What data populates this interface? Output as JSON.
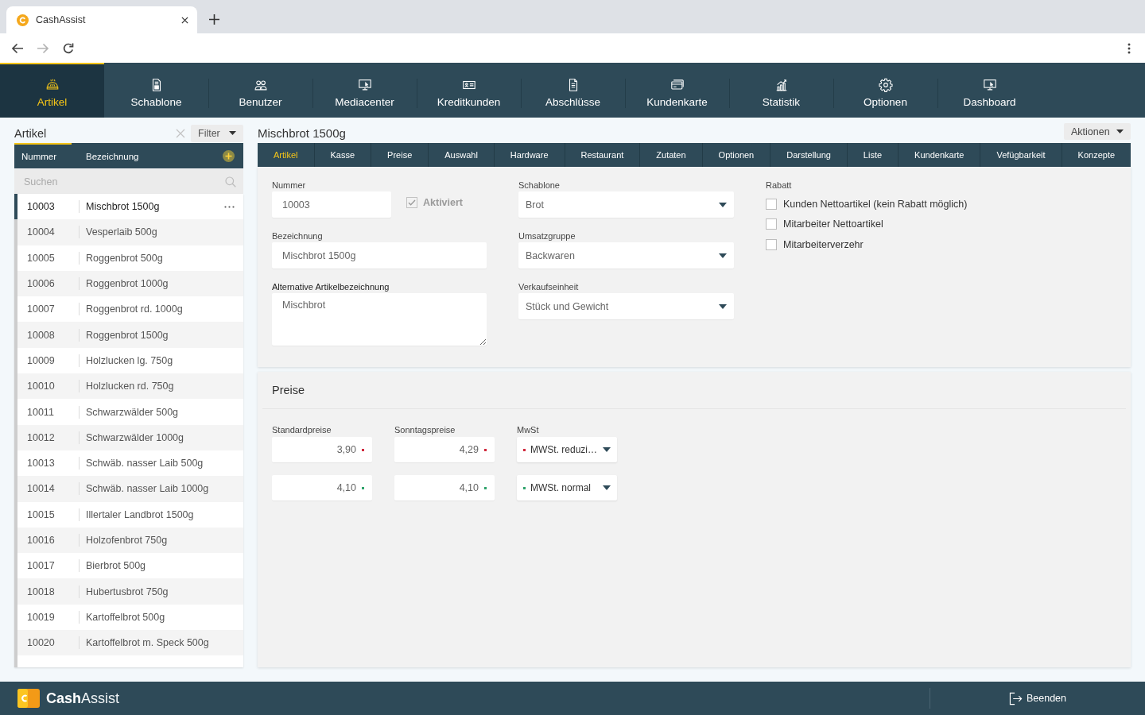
{
  "browser": {
    "tab": {
      "title": "CashAssist"
    },
    "nav_buttons": [
      {
        "kind": "back",
        "disabled": false
      },
      {
        "kind": "forward",
        "disabled": true
      },
      {
        "kind": "reload",
        "disabled": false
      }
    ]
  },
  "main_nav": [
    {
      "label": "Artikel",
      "selected": true
    },
    {
      "label": "Schablone",
      "selected": false
    },
    {
      "label": "Benutzer",
      "selected": false
    },
    {
      "label": "Mediacenter",
      "selected": false
    },
    {
      "label": "Kreditkunden",
      "selected": false
    },
    {
      "label": "Abschlüsse",
      "selected": false
    },
    {
      "label": "Kundenkarte",
      "selected": false
    },
    {
      "label": "Statistik",
      "selected": false
    },
    {
      "label": "Optionen",
      "selected": false
    },
    {
      "label": "Dashboard",
      "selected": false
    }
  ],
  "article_list": {
    "title": "Artikel",
    "filter": "Filter",
    "columns": [
      {
        "label": "Nummer",
        "selected": true
      },
      {
        "label": "Bezeichnung",
        "selected": false
      }
    ],
    "search": {
      "placeholder": "Suchen"
    },
    "rows": [
      {
        "number": "10003",
        "name": "Mischbrot 1500g",
        "selected": true
      },
      {
        "number": "10004",
        "name": "Vesperlaib 500g",
        "selected": false
      },
      {
        "number": "10005",
        "name": "Roggenbrot 500g",
        "selected": false
      },
      {
        "number": "10006",
        "name": "Roggenbrot 1000g",
        "selected": false
      },
      {
        "number": "10007",
        "name": "Roggenbrot rd. 1000g",
        "selected": false
      },
      {
        "number": "10008",
        "name": "Roggenbrot 1500g",
        "selected": false
      },
      {
        "number": "10009",
        "name": "Holzlucken lg. 750g",
        "selected": false
      },
      {
        "number": "10010",
        "name": "Holzlucken rd. 750g",
        "selected": false
      },
      {
        "number": "10011",
        "name": "Schwarzwälder 500g",
        "selected": false
      },
      {
        "number": "10012",
        "name": "Schwarzwälder 1000g",
        "selected": false
      },
      {
        "number": "10013",
        "name": "Schwäb. nasser Laib 500g",
        "selected": false
      },
      {
        "number": "10014",
        "name": "Schwäb. nasser Laib 1000g",
        "selected": false
      },
      {
        "number": "10015",
        "name": "Illertaler Landbrot 1500g",
        "selected": false
      },
      {
        "number": "10016",
        "name": "Holzofenbrot 750g",
        "selected": false
      },
      {
        "number": "10017",
        "name": "Bierbrot 500g",
        "selected": false
      },
      {
        "number": "10018",
        "name": "Hubertusbrot 750g",
        "selected": false
      },
      {
        "number": "10019",
        "name": "Kartoffelbrot 500g",
        "selected": false
      },
      {
        "number": "10020",
        "name": "Kartoffelbrot m. Speck 500g",
        "selected": false
      }
    ]
  },
  "detail": {
    "title": "Mischbrot 1500g",
    "actions": "Aktionen",
    "tabs": [
      {
        "label": "Artikel",
        "selected": true
      },
      {
        "label": "Kasse",
        "selected": false
      },
      {
        "label": "Preise",
        "selected": false
      },
      {
        "label": "Auswahl",
        "selected": false
      },
      {
        "label": "Hardware",
        "selected": false
      },
      {
        "label": "Restaurant",
        "selected": false
      },
      {
        "label": "Zutaten",
        "selected": false
      },
      {
        "label": "Optionen",
        "selected": false
      },
      {
        "label": "Darstellung",
        "selected": false
      },
      {
        "label": "Liste",
        "selected": false
      },
      {
        "label": "Kundenkarte",
        "selected": false
      },
      {
        "label": "Vefügbarkeit",
        "selected": false
      },
      {
        "label": "Konzepte",
        "selected": false
      }
    ],
    "form": {
      "nummer": {
        "label": "Nummer",
        "value": "10003"
      },
      "aktiviert": {
        "label": "Aktiviert",
        "checked": true,
        "disabled": true
      },
      "bezeichnung": {
        "label": "Bezeichnung",
        "value": "Mischbrot 1500g"
      },
      "alternative_bezeichnung": {
        "label": "Alternative Artikelbezeichnung",
        "value": "Mischbrot"
      },
      "schablone": {
        "label": "Schablone",
        "value": "Brot"
      },
      "umsatzgruppe": {
        "label": "Umsatzgruppe",
        "value": "Backwaren"
      },
      "verkaufseinheit": {
        "label": "Verkaufseinheit",
        "value": "Stück und Gewicht"
      },
      "rabatt": {
        "label": "Rabatt",
        "options": [
          {
            "label": "Kunden Nettoartikel (kein Rabatt möglich)",
            "checked": false
          },
          {
            "label": "Mitarbeiter Nettoartikel",
            "checked": false
          },
          {
            "label": "Mitarbeiterverzehr",
            "checked": false
          }
        ]
      }
    }
  },
  "preise": {
    "title": "Preise",
    "columns": [
      "Standardpreise",
      "Sonntagspreise",
      "MwSt"
    ],
    "rows": [
      {
        "standard": {
          "value": "3,90",
          "color": "#d0283c"
        },
        "sunday": {
          "value": "4,29",
          "color": "#d0283c"
        },
        "vat": {
          "value": "MWSt. reduzi…",
          "color": "#d0283c"
        }
      },
      {
        "standard": {
          "value": "4,10",
          "color": "#2fa36b"
        },
        "sunday": {
          "value": "4,10",
          "color": "#2fa36b"
        },
        "vat": {
          "value": "MWSt. normal",
          "color": "#2fa36b"
        }
      }
    ]
  },
  "footer": {
    "brand": "**Cash**Assist",
    "logout": "Beenden"
  }
}
